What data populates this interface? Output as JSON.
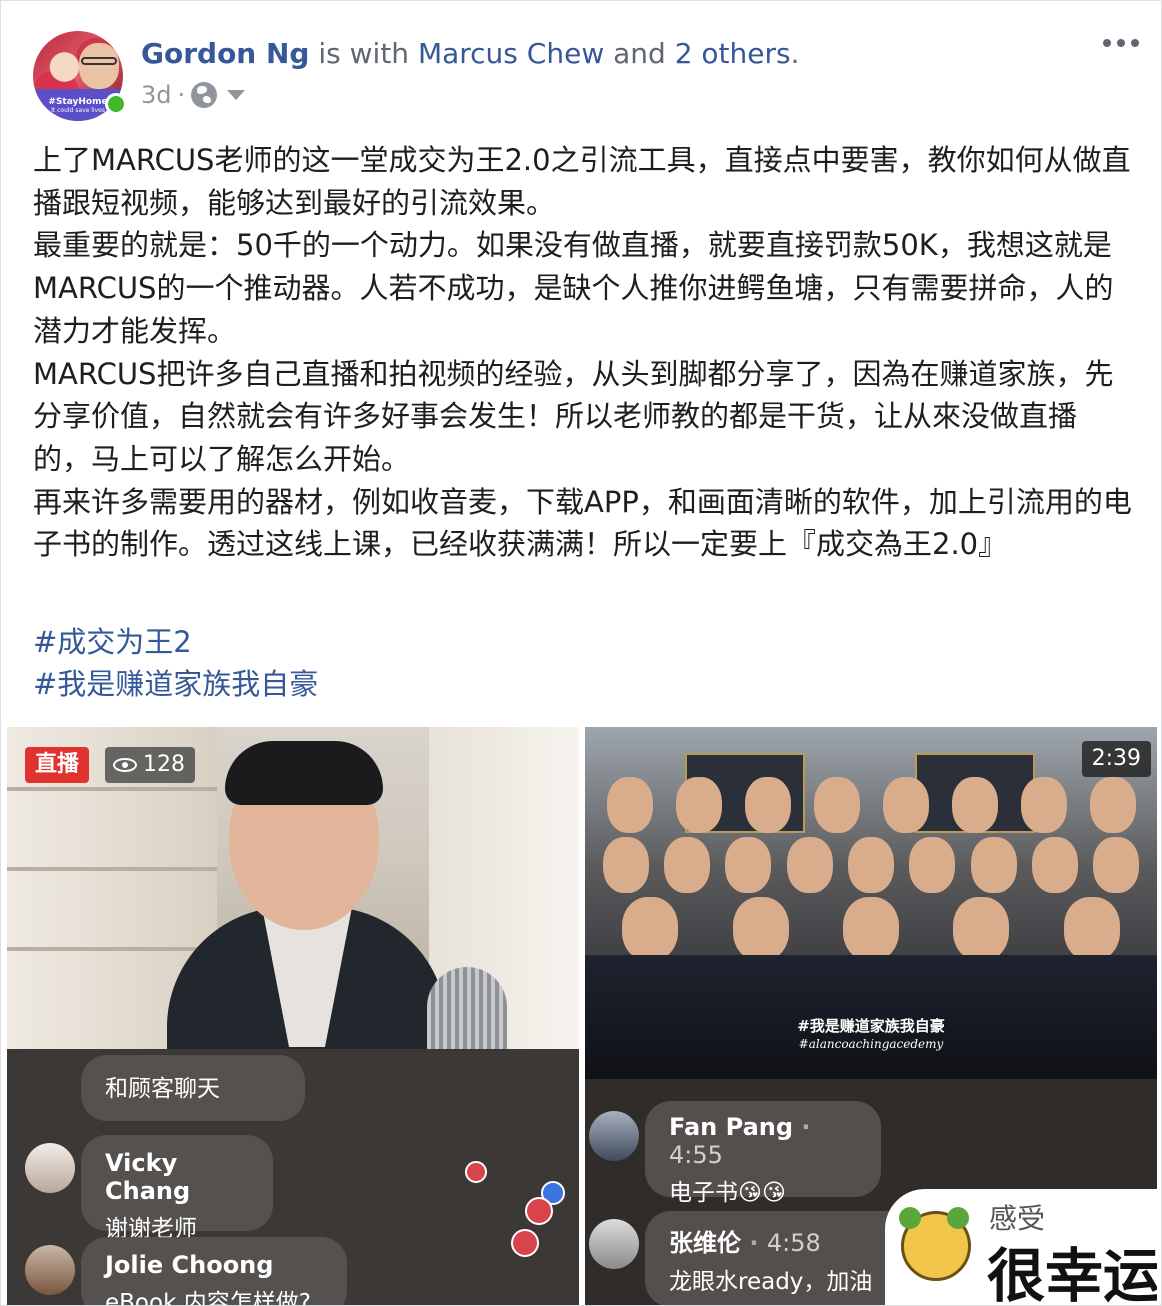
{
  "post": {
    "author": "Gordon Ng",
    "with_text": " is with ",
    "tagged": "Marcus Chew",
    "and_text": " and ",
    "others": "2 others",
    "period": ".",
    "time": "3d",
    "time_sep": "·",
    "avatar_badge": "#StayHome",
    "avatar_sub": "It could save lives",
    "privacy_icon": "globe-icon",
    "paragraphs": [
      "上了MARCUS老师的这一堂成交为王2.0之引流工具，直接点中要害，教你如何从做直播跟短视频，能够达到最好的引流效果。",
      "最重要的就是：50千的一个动力。如果没有做直播，就要直接罚款50K，我想这就是MARCUS的一个推动器。人若不成功，是缺个人推你进鳄鱼塘，只有需要拼命，人的潜力才能发挥。",
      "MARCUS把许多自己直播和拍视频的经验，从头到脚都分享了，因為在赚道家族，先分享价值，自然就会有许多好事会发生！所以老师教的都是干货，让从來没做直播的，马上可以了解怎么开始。",
      "再来许多需要用的器材，例如收音麦，下载APP，和画面清晰的软件，加上引流用的电子书的制作。透过这线上课，已经收获满满！所以一定要上『成交為王2.0』"
    ],
    "hashtags": [
      "#成交为王2",
      "#我是赚道家族我自豪"
    ]
  },
  "left_video": {
    "live_label": "直播",
    "viewers": "128",
    "comments": [
      {
        "name": "",
        "text": "和顾客聊天"
      },
      {
        "name": "Vicky  Chang",
        "text": "谢谢老师"
      },
      {
        "name": "Jolie Choong",
        "text": "eBook 内容怎样做?"
      }
    ]
  },
  "right_video": {
    "duration": "2:39",
    "watermark_tag": "#我是赚道家族我自豪",
    "watermark_sub": "#alancoachingacedemy",
    "comments": [
      {
        "name": "Fan Pang",
        "sep": "·",
        "time": "4:55",
        "text": "电子书😘😘"
      },
      {
        "name": "张维伦",
        "sep": "·",
        "time": "4:58",
        "text": "龙眼水ready，加油"
      }
    ],
    "sticker_small": "感受",
    "sticker_big": "很幸运"
  },
  "colors": {
    "link": "#365899",
    "meta": "#90949c",
    "live": "#e0332f",
    "online": "#42b72a"
  }
}
